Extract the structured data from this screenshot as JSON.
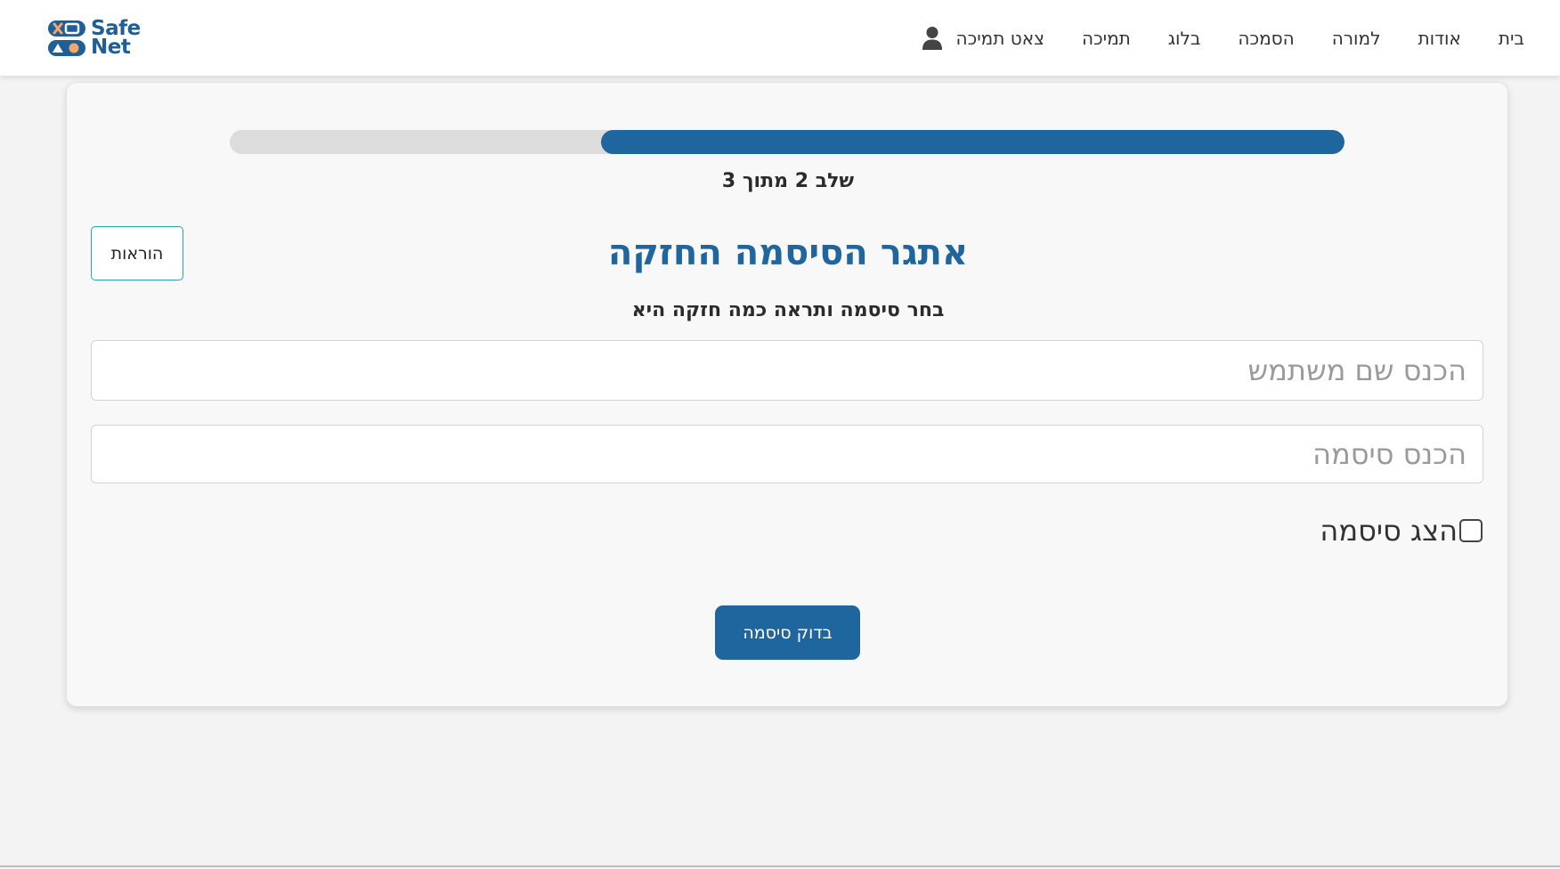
{
  "header": {
    "logo": {
      "line1": "Safe",
      "line2": "Net"
    },
    "nav": [
      "בית",
      "אודות",
      "למורה",
      "הסמכה",
      "בלוג",
      "תמיכה",
      "צאט תמיכה"
    ],
    "user_icon": "user-icon"
  },
  "challenge": {
    "progress": {
      "fraction": 0.667
    },
    "step_text": "שלב 2 מתוך 3",
    "title": "אתגר הסיסמה החזקה",
    "subtitle": "בחר סיסמה ותראה כמה חזקה היא",
    "instructions_label": "הוראות",
    "username_placeholder": "הכנס שם משתמש",
    "password_placeholder": "הכנס סיסמה",
    "show_password_label": "הצג סיסמה",
    "show_password_checked": false,
    "check_button_label": "בדוק סיסמה"
  },
  "colors": {
    "brand": "#1f669e",
    "logo_accent": "#f2a66b",
    "progress_track": "#dcdcdc",
    "button_border": "#2aa6a6"
  }
}
